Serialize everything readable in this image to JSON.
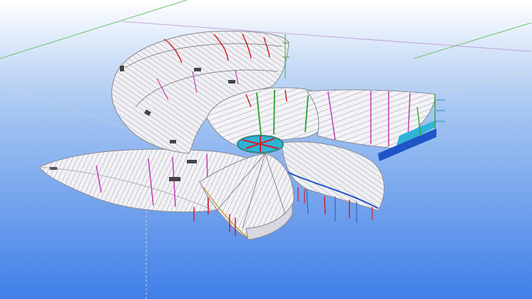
{
  "viewport": {
    "background_top": "#ffffff",
    "background_mid": "#a9c8f2",
    "background_bottom": "#3f7fe8"
  },
  "colors": {
    "roof_fill": "#eeeef2",
    "roof_shade": "#d4d4dc",
    "rib_line": "#8a8a92",
    "red_member": "#d0202a",
    "magenta_member": "#c040b0",
    "green_member": "#3aa83a",
    "blue_column": "#1f55c8",
    "cyan_glass": "#2fb4d8",
    "grid_green": "#6fc36f",
    "grid_purple": "#b889c9",
    "dashed_axis": "#c9c9c9",
    "dark_panel": "#444444"
  },
  "icons": {
    "axis_lines": "reference-grid-icon",
    "oculus": "ring-oculus-icon"
  }
}
